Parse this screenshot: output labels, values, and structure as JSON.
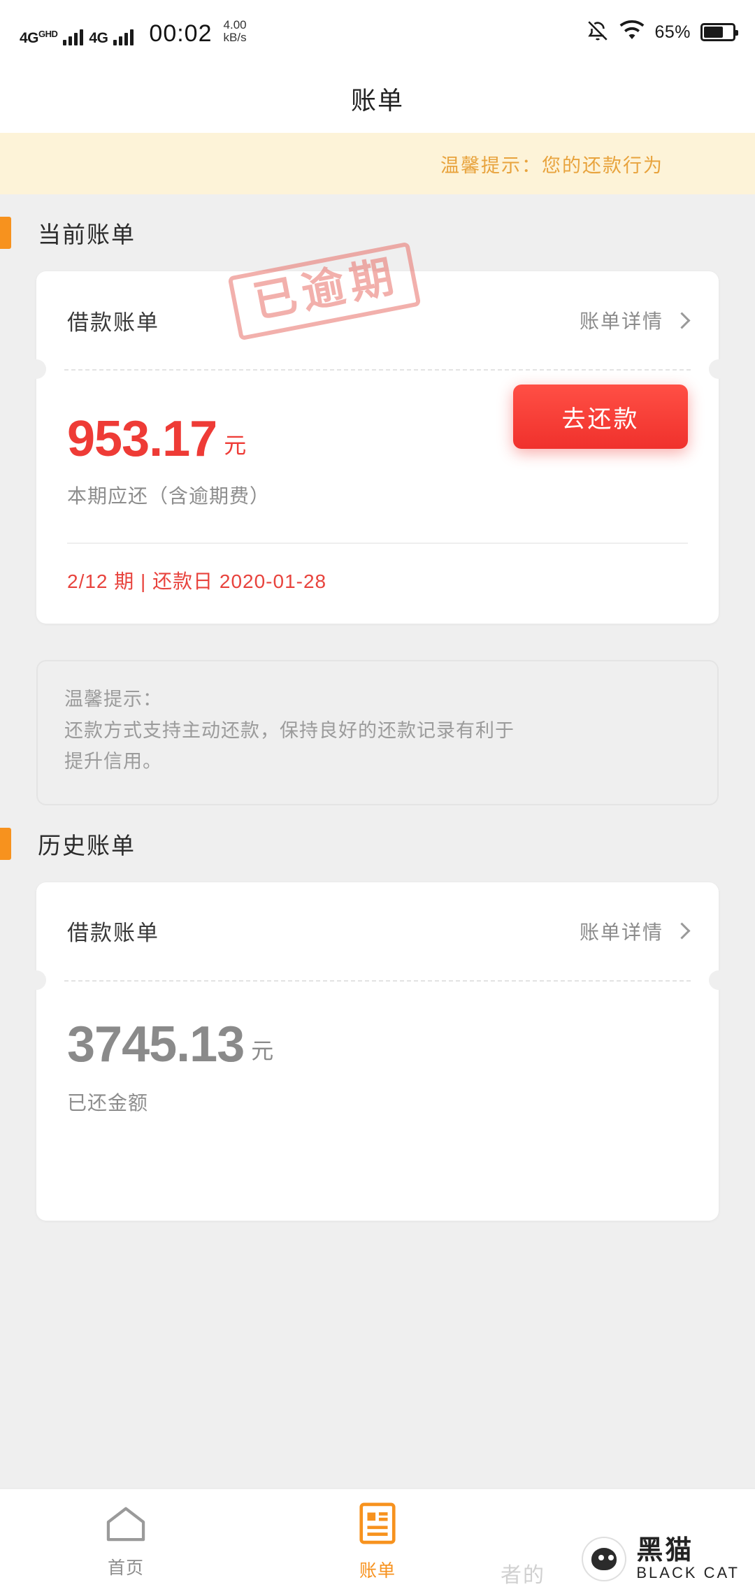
{
  "statusbar": {
    "network_label": "4G",
    "network_sup": "GHD",
    "network_label2": "4G",
    "clock": "00:02",
    "speed_value": "4.00",
    "speed_unit": "kB/s",
    "battery_text": "65%",
    "mute_icon": "bell-off-icon",
    "wifi_icon": "wifi-icon",
    "battery_icon": "battery-icon"
  },
  "header": {
    "title": "账单"
  },
  "notice": {
    "text": "温馨提示：您的还款行为"
  },
  "current_section": {
    "title": "当前账单",
    "card": {
      "label": "借款账单",
      "detail_link": "账单详情",
      "stamp": "已逾期",
      "amount": "953.17",
      "amount_unit": "元",
      "amount_caption": "本期应还（含逾期费）",
      "pay_button": "去还款",
      "meta": "2/12 期 | 还款日 2020-01-28"
    }
  },
  "tips": {
    "line1": "温馨提示：",
    "line2": "还款方式支持主动还款，保持良好的还款记录有利于",
    "line3": "提升信用。"
  },
  "history_section": {
    "title": "历史账单",
    "card": {
      "label": "借款账单",
      "detail_link": "账单详情",
      "amount": "3745.13",
      "amount_unit": "元",
      "amount_caption": "已还金额"
    }
  },
  "tabbar": {
    "items": [
      {
        "label": "首页",
        "icon": "home-icon",
        "active": false
      },
      {
        "label": "账单",
        "icon": "bill-icon",
        "active": true
      },
      {
        "label": "",
        "icon": "profile-icon",
        "active": false
      }
    ]
  },
  "watermark": {
    "cn": "黑猫",
    "en": "BLACK CAT",
    "ghost": "者的"
  },
  "colors": {
    "accent_orange": "#f7921e",
    "danger_red": "#ee3b36",
    "notice_bg": "#fdf3d8",
    "notice_text": "#e8a33d",
    "page_bg": "#efefef"
  }
}
